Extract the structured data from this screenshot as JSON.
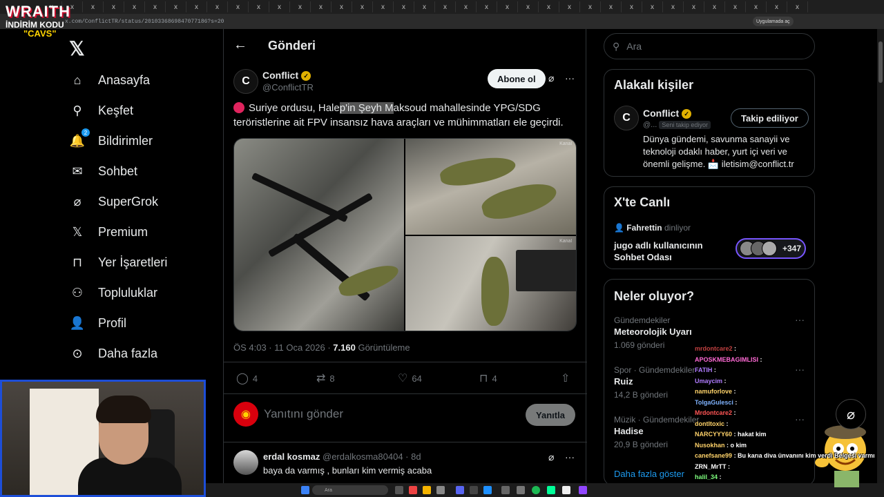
{
  "browser": {
    "tab_label": "x",
    "url": "x.com/ConflictTR/status/2010336869847077186?s=20",
    "app_button": "Uygulamada aç"
  },
  "overlay": {
    "brand": "WRAITH",
    "promo_line": "İNDİRİM KODU",
    "promo_code": "\"CAVS\""
  },
  "nav": {
    "items": [
      {
        "label": "Anasayfa",
        "icon": "home-icon"
      },
      {
        "label": "Keşfet",
        "icon": "search-icon"
      },
      {
        "label": "Bildirimler",
        "icon": "bell-icon",
        "badge": "2"
      },
      {
        "label": "Sohbet",
        "icon": "mail-icon"
      },
      {
        "label": "SuperGrok",
        "icon": "grok-icon"
      },
      {
        "label": "Premium",
        "icon": "x-icon"
      },
      {
        "label": "Yer İşaretleri",
        "icon": "bookmark-icon"
      },
      {
        "label": "Topluluklar",
        "icon": "people-icon"
      },
      {
        "label": "Profil",
        "icon": "user-icon"
      },
      {
        "label": "Daha fazla",
        "icon": "more-circle-icon"
      }
    ]
  },
  "post": {
    "header_title": "Gönderi",
    "author_name": "Conflict",
    "author_handle": "@ConflictTR",
    "subscribe_label": "Abone ol",
    "text_before": "Suriye ordusu, Hale",
    "text_highlight": "p'in Şeyh M",
    "text_after": "aksoud mahallesinde YPG/SDG teröristlerine ait FPV insansız hava araçları ve mühimmatları ele geçirdi.",
    "watermark": "Kanal",
    "time": "ÖS 4:03 · 11 Oca 2026 ·",
    "views": "7.160",
    "views_label": "Görüntüleme",
    "replies": "4",
    "reposts": "8",
    "likes": "64",
    "bookmarks": "4"
  },
  "reply_box": {
    "placeholder": "Yanıtını gönder",
    "button": "Yanıtla"
  },
  "comment": {
    "name": "erdal kosmaz",
    "handle": "@erdalkosma80404 · 8d",
    "text": "baya da varmış , bunları kim vermiş acaba"
  },
  "sidebar": {
    "search_placeholder": "Ara",
    "related": {
      "title": "Alakalı kişiler",
      "name": "Conflict",
      "handle": "@...",
      "follows_you": "Seni takip ediyor",
      "follow_button": "Takip ediliyor",
      "bio": "Dünya gündemi, savunma sanayii ve teknoloji odaklı haber, yurt içi veri ve önemli gelişme. 📩 iletisim@conflict.tr"
    },
    "live": {
      "title": "X'te Canlı",
      "host": "Fahrettin",
      "host_status": "dinliyor",
      "room_line1": "jugo adlı kullanıcının",
      "room_line2": "Sohbet Odası",
      "listener_count": "+347"
    },
    "trends": {
      "title": "Neler oluyor?",
      "items": [
        {
          "category": "Gündemdekiler",
          "name": "Meteorolojik Uyarı",
          "count": "1.069 gönderi"
        },
        {
          "category": "Spor · Gündemdekiler",
          "name": "Ruiz",
          "count": "14,2 B gönderi"
        },
        {
          "category": "Müzik · Gündemdekiler",
          "name": "Hadise",
          "count": "20,9 B gönderi"
        }
      ],
      "show_more": "Daha fazla göster"
    }
  },
  "chat": [
    {
      "user": "mrdontcare2",
      "msg": ":",
      "color": "#c04040"
    },
    {
      "user": "APOSKMEBAGIMLISI",
      "msg": ":",
      "color": "#ff6ad5"
    },
    {
      "user": "FATIH",
      "msg": ":",
      "color": "#b07cff"
    },
    {
      "user": "Umaycim",
      "msg": ":",
      "color": "#b07cff"
    },
    {
      "user": "namuforlove",
      "msg": ":",
      "color": "#ffd36a"
    },
    {
      "user": "TolgaGulesci",
      "msg": ":",
      "color": "#7fb3ff"
    },
    {
      "user": "Mrdontcare2",
      "msg": ":",
      "color": "#ff5555"
    },
    {
      "user": "dontltoxic",
      "msg": ":",
      "color": "#ffd36a"
    },
    {
      "user": "NARCYYY60",
      "msg": ": hakat kim",
      "color": "#ffd36a"
    },
    {
      "user": "Nusokhan",
      "msg": ": o kim",
      "color": "#ffd36a"
    },
    {
      "user": "canefsane99",
      "msg": ": Bu karıa diva ünvanını kim verdi Belgesi varmı",
      "color": "#ffd36a"
    },
    {
      "user": "ZRN_MrTT",
      "msg": ":",
      "color": "#ffffff"
    },
    {
      "user": "halil_34",
      "msg": ":",
      "color": "#7fff7f"
    }
  ],
  "taskbar": {
    "search_label": "Ara"
  }
}
